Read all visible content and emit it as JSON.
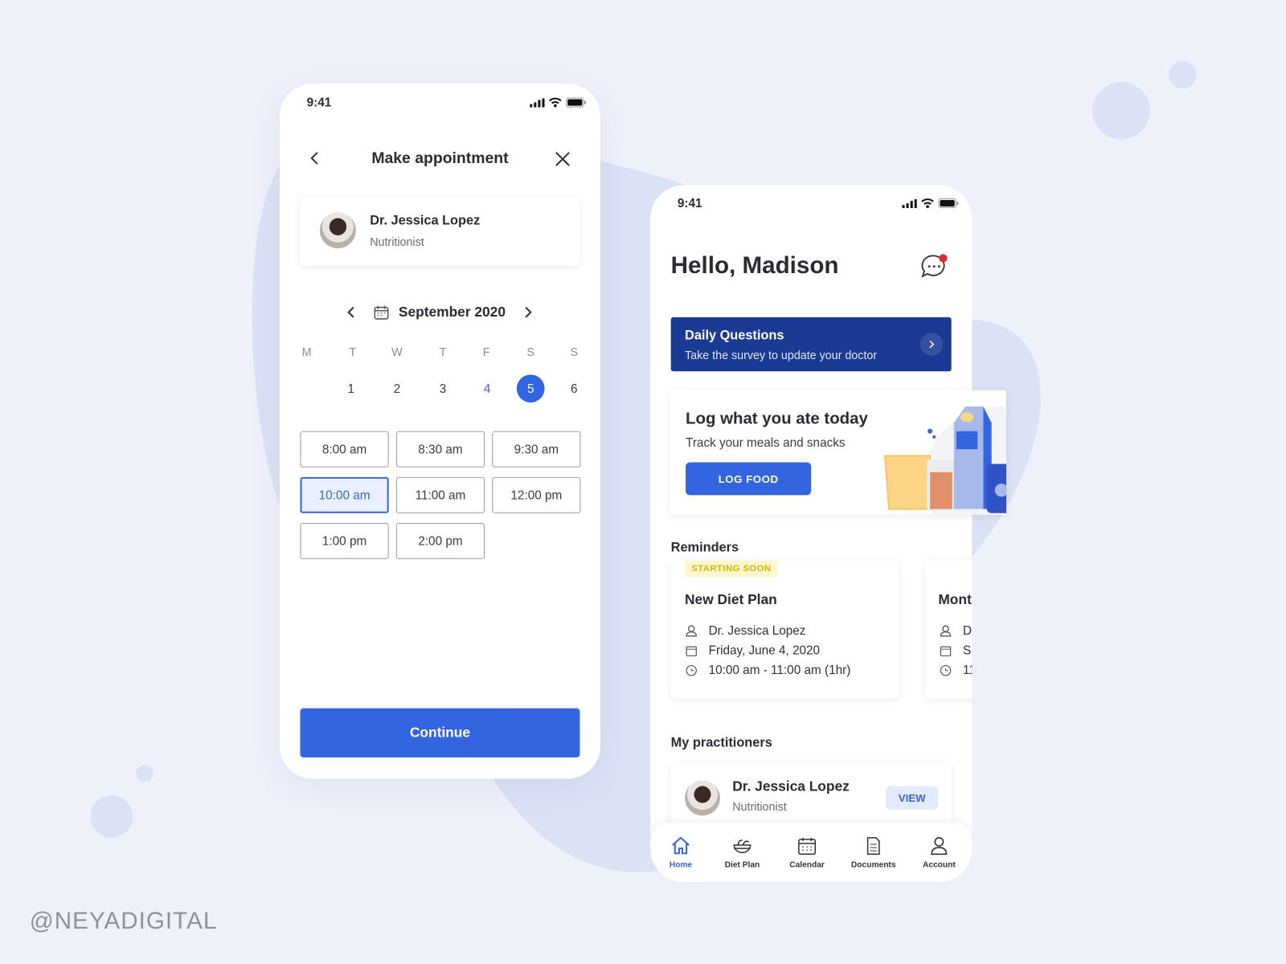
{
  "watermark": "@NEYADIGITAL",
  "left_phone": {
    "status_time": "9:41",
    "title": "Make appointment",
    "doctor": {
      "name": "Dr. Jessica Lopez",
      "role": "Nutritionist"
    },
    "month": "September 2020",
    "weekdays": [
      "M",
      "T",
      "W",
      "T",
      "F",
      "S",
      "S"
    ],
    "days": [
      "1",
      "2",
      "3",
      "4",
      "5",
      "6"
    ],
    "today_day": "4",
    "selected_day": "5",
    "slots": [
      "8:00 am",
      "8:30 am",
      "9:30 am",
      "10:00 am",
      "11:00 am",
      "12:00 pm",
      "1:00 pm",
      "2:00 pm"
    ],
    "selected_slot": "10:00 am",
    "continue_label": "Continue"
  },
  "right_phone": {
    "status_time": "9:41",
    "greeting": "Hello, Madison",
    "daily": {
      "title": "Daily Questions",
      "subtitle": "Take the survey to update your doctor"
    },
    "log": {
      "title": "Log what you ate today",
      "subtitle": "Track your meals and snacks",
      "button": "LOG FOOD"
    },
    "reminders_title": "Reminders",
    "reminders": [
      {
        "badge": "STARTING SOON",
        "title": "New Diet Plan",
        "doctor": "Dr. Jessica Lopez",
        "date": "Friday, June 4, 2020",
        "time": "10:00 am - 11:00 am (1hr)"
      },
      {
        "title": "Mont",
        "doctor": "D",
        "date": "S",
        "time": "11"
      }
    ],
    "practitioners_title": "My practitioners",
    "practitioner": {
      "name": "Dr. Jessica Lopez",
      "role": "Nutritionist",
      "button": "VIEW"
    },
    "nav": [
      {
        "label": "Home",
        "icon": "home-icon"
      },
      {
        "label": "Diet Plan",
        "icon": "salad-bowl-icon"
      },
      {
        "label": "Calendar",
        "icon": "calendar-icon"
      },
      {
        "label": "Documents",
        "icon": "document-icon"
      },
      {
        "label": "Account",
        "icon": "user-icon"
      }
    ]
  },
  "colors": {
    "primary": "#3465e0",
    "navy": "#1b3a93",
    "badge_bg": "#fdf6cf",
    "badge_text": "#d4b800",
    "notify": "#e8262b",
    "background": "#eef1fa"
  }
}
